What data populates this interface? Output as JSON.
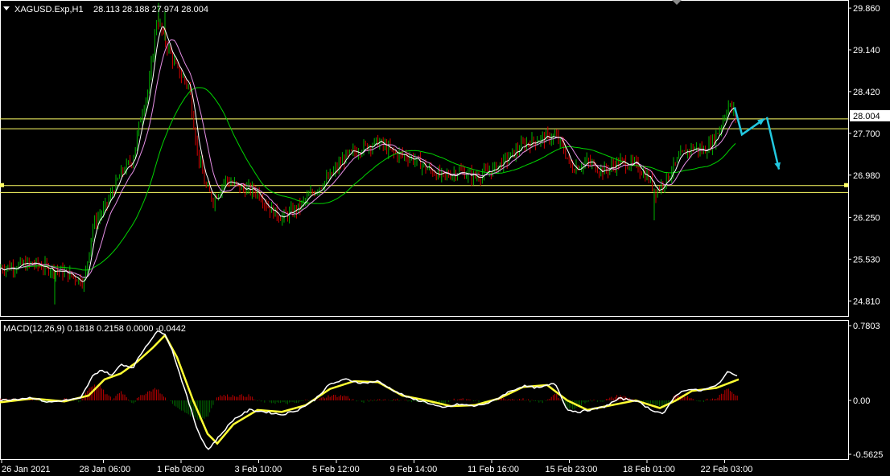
{
  "header": {
    "symbol": "XAGUSD.Exp,H1",
    "ohlc": "28.113 28.188 27.974 28.004",
    "menu_icon": "triangle-down-icon"
  },
  "macd_header": {
    "text": "MACD(12,26,9) 0.1818 0.2158 0.0000 -0.0442"
  },
  "colors": {
    "background": "#000000",
    "axis": "#ffffff",
    "bull_candle": "#00b300",
    "bear_candle": "#d40000",
    "ma_fast": "#ffffff",
    "ma_mid": "#e890e8",
    "ma_slow": "#00d400",
    "levels": "#ffff66",
    "arrows": "#22c8e0",
    "macd_line": "#ffffff",
    "signal_line": "#ffff33",
    "hist_pos": "#c00000",
    "hist_neg": "#006400",
    "price_tag_bg": "#ffffff",
    "price_tag_text": "#000000"
  },
  "chart_data": [
    {
      "type": "candlestick",
      "symbol": "XAGUSD.Exp",
      "timeframe": "H1",
      "y_ticks": [
        "29.860",
        "29.140",
        "28.420",
        "27.700",
        "26.980",
        "26.250",
        "25.530",
        "24.810"
      ],
      "ylim": [
        24.55,
        30.0
      ],
      "current_price": "28.004",
      "horizontal_levels": [
        27.95,
        27.78,
        26.8,
        26.68
      ],
      "approx_close_path": [
        [
          0,
          25.38
        ],
        [
          40,
          25.45
        ],
        [
          80,
          25.3
        ],
        [
          105,
          25.15
        ],
        [
          115,
          26.1
        ],
        [
          130,
          26.4
        ],
        [
          150,
          27.0
        ],
        [
          165,
          27.25
        ],
        [
          175,
          28.0
        ],
        [
          185,
          28.5
        ],
        [
          195,
          29.7
        ],
        [
          205,
          29.3
        ],
        [
          220,
          28.8
        ],
        [
          235,
          28.5
        ],
        [
          245,
          27.4
        ],
        [
          255,
          26.8
        ],
        [
          265,
          26.55
        ],
        [
          280,
          26.9
        ],
        [
          300,
          26.75
        ],
        [
          320,
          26.7
        ],
        [
          335,
          26.4
        ],
        [
          350,
          26.25
        ],
        [
          370,
          26.4
        ],
        [
          390,
          26.7
        ],
        [
          410,
          26.95
        ],
        [
          430,
          27.3
        ],
        [
          450,
          27.45
        ],
        [
          470,
          27.55
        ],
        [
          490,
          27.35
        ],
        [
          510,
          27.3
        ],
        [
          530,
          27.1
        ],
        [
          550,
          26.95
        ],
        [
          570,
          27.05
        ],
        [
          590,
          26.95
        ],
        [
          610,
          27.05
        ],
        [
          630,
          27.25
        ],
        [
          650,
          27.5
        ],
        [
          670,
          27.6
        ],
        [
          690,
          27.65
        ],
        [
          700,
          27.45
        ],
        [
          710,
          27.1
        ],
        [
          730,
          27.2
        ],
        [
          750,
          27.05
        ],
        [
          770,
          27.2
        ],
        [
          790,
          27.15
        ],
        [
          805,
          26.95
        ],
        [
          815,
          26.7
        ],
        [
          830,
          26.95
        ],
        [
          845,
          27.3
        ],
        [
          860,
          27.45
        ],
        [
          875,
          27.4
        ],
        [
          885,
          27.55
        ],
        [
          895,
          27.8
        ],
        [
          905,
          28.2
        ],
        [
          915,
          28.0
        ]
      ],
      "forecast_arrows": [
        [
          [
            913,
            28.15
          ],
          [
            922,
            27.68
          ],
          [
            950,
            27.95
          ]
        ],
        [
          [
            953,
            27.98
          ],
          [
            968,
            27.08
          ]
        ]
      ]
    },
    {
      "type": "macd",
      "params": "MACD(12,26,9)",
      "values": {
        "macd": 0.1818,
        "signal": 0.2158,
        "histogram": 0.0,
        "diff": -0.0442
      },
      "y_ticks": [
        "0.7803",
        "0.00",
        "-0.5625"
      ],
      "ylim": [
        -0.5625,
        0.7803
      ],
      "x_labels": [
        "26 Jan 2021",
        "28 Jan 06:00",
        "1 Feb 08:00",
        "3 Feb 10:00",
        "5 Feb 12:00",
        "9 Feb 14:00",
        "11 Feb 16:00",
        "15 Feb 23:00",
        "18 Feb 01:00",
        "22 Feb 03:00"
      ],
      "macd_path": [
        [
          0,
          0.0
        ],
        [
          40,
          0.03
        ],
        [
          60,
          -0.02
        ],
        [
          80,
          0.0
        ],
        [
          100,
          0.02
        ],
        [
          115,
          0.25
        ],
        [
          125,
          0.32
        ],
        [
          140,
          0.26
        ],
        [
          150,
          0.38
        ],
        [
          165,
          0.34
        ],
        [
          180,
          0.55
        ],
        [
          195,
          0.72
        ],
        [
          205,
          0.7
        ],
        [
          215,
          0.5
        ],
        [
          230,
          0.1
        ],
        [
          245,
          -0.3
        ],
        [
          258,
          -0.52
        ],
        [
          270,
          -0.4
        ],
        [
          290,
          -0.2
        ],
        [
          310,
          -0.1
        ],
        [
          330,
          -0.12
        ],
        [
          350,
          -0.15
        ],
        [
          370,
          -0.1
        ],
        [
          390,
          0.0
        ],
        [
          410,
          0.17
        ],
        [
          430,
          0.22
        ],
        [
          450,
          0.18
        ],
        [
          470,
          0.2
        ],
        [
          490,
          0.1
        ],
        [
          510,
          0.02
        ],
        [
          530,
          -0.02
        ],
        [
          550,
          -0.08
        ],
        [
          570,
          -0.04
        ],
        [
          590,
          -0.06
        ],
        [
          610,
          -0.02
        ],
        [
          630,
          0.08
        ],
        [
          650,
          0.15
        ],
        [
          670,
          0.13
        ],
        [
          690,
          0.18
        ],
        [
          705,
          -0.1
        ],
        [
          720,
          -0.12
        ],
        [
          750,
          -0.07
        ],
        [
          770,
          0.02
        ],
        [
          790,
          0.0
        ],
        [
          810,
          -0.1
        ],
        [
          825,
          -0.14
        ],
        [
          840,
          0.06
        ],
        [
          855,
          0.12
        ],
        [
          870,
          0.1
        ],
        [
          890,
          0.15
        ],
        [
          905,
          0.3
        ],
        [
          918,
          0.26
        ]
      ],
      "signal_path": [
        [
          0,
          -0.02
        ],
        [
          40,
          0.02
        ],
        [
          80,
          -0.01
        ],
        [
          110,
          0.05
        ],
        [
          130,
          0.22
        ],
        [
          150,
          0.28
        ],
        [
          170,
          0.4
        ],
        [
          190,
          0.55
        ],
        [
          205,
          0.68
        ],
        [
          220,
          0.45
        ],
        [
          240,
          0.0
        ],
        [
          258,
          -0.35
        ],
        [
          270,
          -0.45
        ],
        [
          290,
          -0.25
        ],
        [
          320,
          -0.1
        ],
        [
          350,
          -0.12
        ],
        [
          380,
          -0.05
        ],
        [
          410,
          0.12
        ],
        [
          440,
          0.2
        ],
        [
          470,
          0.19
        ],
        [
          500,
          0.05
        ],
        [
          530,
          0.0
        ],
        [
          560,
          -0.06
        ],
        [
          590,
          -0.05
        ],
        [
          620,
          0.02
        ],
        [
          650,
          0.14
        ],
        [
          680,
          0.16
        ],
        [
          705,
          0.0
        ],
        [
          730,
          -0.1
        ],
        [
          760,
          -0.05
        ],
        [
          790,
          0.0
        ],
        [
          820,
          -0.08
        ],
        [
          840,
          0.0
        ],
        [
          860,
          0.1
        ],
        [
          890,
          0.13
        ],
        [
          918,
          0.22
        ]
      ]
    }
  ]
}
